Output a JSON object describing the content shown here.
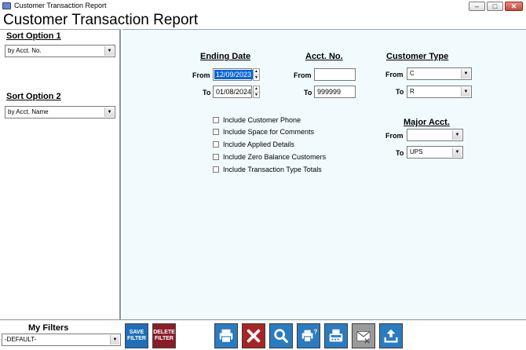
{
  "window": {
    "title": "Customer Transaction Report",
    "min": "–",
    "max": "□",
    "close": "✕"
  },
  "report_title": "Customer Transaction Report",
  "sort_option_1": {
    "label": "Sort Option 1",
    "value": "by Acct. No."
  },
  "sort_option_2": {
    "label": "Sort Option 2",
    "value": "by Acct. Name"
  },
  "ending_date": {
    "title": "Ending Date",
    "from_label": "From",
    "from_value": "12/09/2023",
    "to_label": "To",
    "to_value": "01/08/2024"
  },
  "acct_no": {
    "title": "Acct. No.",
    "from_label": "From",
    "from_value": "",
    "to_label": "To",
    "to_value": "999999"
  },
  "customer_type": {
    "title": "Customer Type",
    "from_label": "From",
    "from_value": "C",
    "to_label": "To",
    "to_value": "R"
  },
  "major_acct": {
    "title": "Major Acct.",
    "from_label": "From",
    "from_value": "",
    "to_label": "To",
    "to_value": "UPS"
  },
  "options": [
    {
      "label": "Include Customer Phone",
      "checked": false
    },
    {
      "label": "Include Space for Comments",
      "checked": false
    },
    {
      "label": "Include Applied Details",
      "checked": false
    },
    {
      "label": "Include Zero Balance Customers",
      "checked": false
    },
    {
      "label": "Include Transaction Type Totals",
      "checked": false
    }
  ],
  "filters": {
    "label": "My Filters",
    "value": "-DEFAULT-",
    "save_line1": "SAVE",
    "save_line2": "FILTER",
    "delete_line1": "DELETE",
    "delete_line2": "FILTER"
  },
  "toolbar": [
    "print-icon",
    "cancel-icon",
    "preview-icon",
    "print-setup-icon",
    "fax-icon",
    "email-icon",
    "export-icon"
  ],
  "colors": {
    "panel_bg": "#f1fbfe",
    "toolbar_blue": "#2b7bc0",
    "cancel_red": "#a82525",
    "save_blue": "#1f6fb8",
    "delete_maroon": "#8a1d2a",
    "date_highlight": "#0a64d8"
  }
}
